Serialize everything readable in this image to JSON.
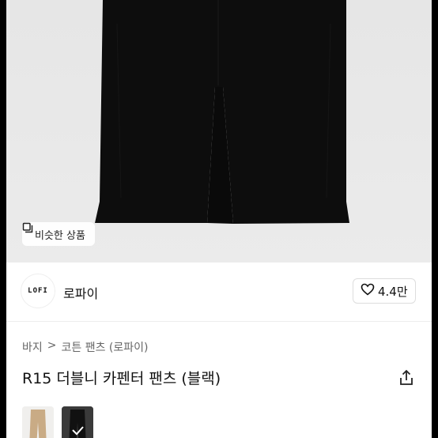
{
  "hero": {
    "similar_button_label": "비슷한 상품",
    "similar_icon": "stack-icon"
  },
  "brand": {
    "logo_text": "LOFI",
    "name": "로파이",
    "like_count": "4.4만",
    "like_icon": "heart-icon"
  },
  "product": {
    "breadcrumb": [
      "바지",
      "코튼 팬츠 (로파이)"
    ],
    "breadcrumb_separator": ">",
    "title": "R15 더블니 카펜터 팬츠 (블랙)",
    "share_icon": "share-icon"
  },
  "colors": {
    "accent_dark": "#111111",
    "hero_bg": "#e9e9e9"
  }
}
